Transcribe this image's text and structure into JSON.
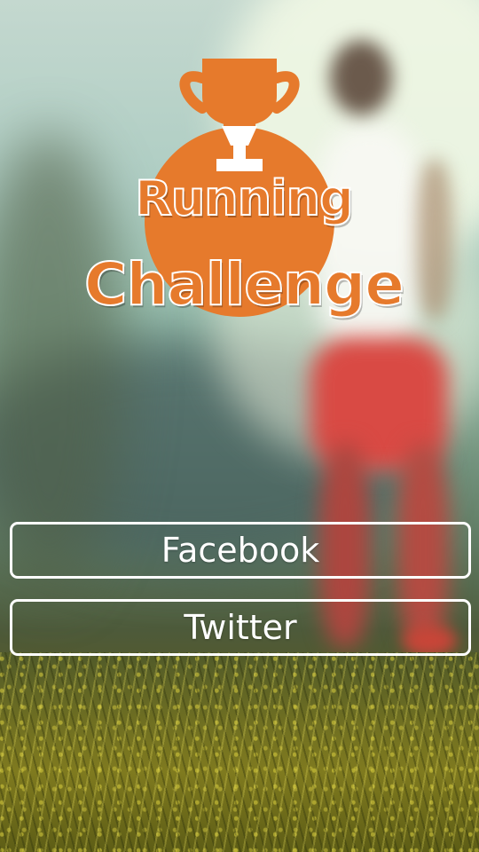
{
  "app": {
    "title_line1": "Running",
    "title_line2": "Challenge",
    "logo_icon": "trophy-icon",
    "accent_color": "#e67a2c"
  },
  "buttons": {
    "facebook_label": "Facebook",
    "twitter_label": "Twitter"
  }
}
